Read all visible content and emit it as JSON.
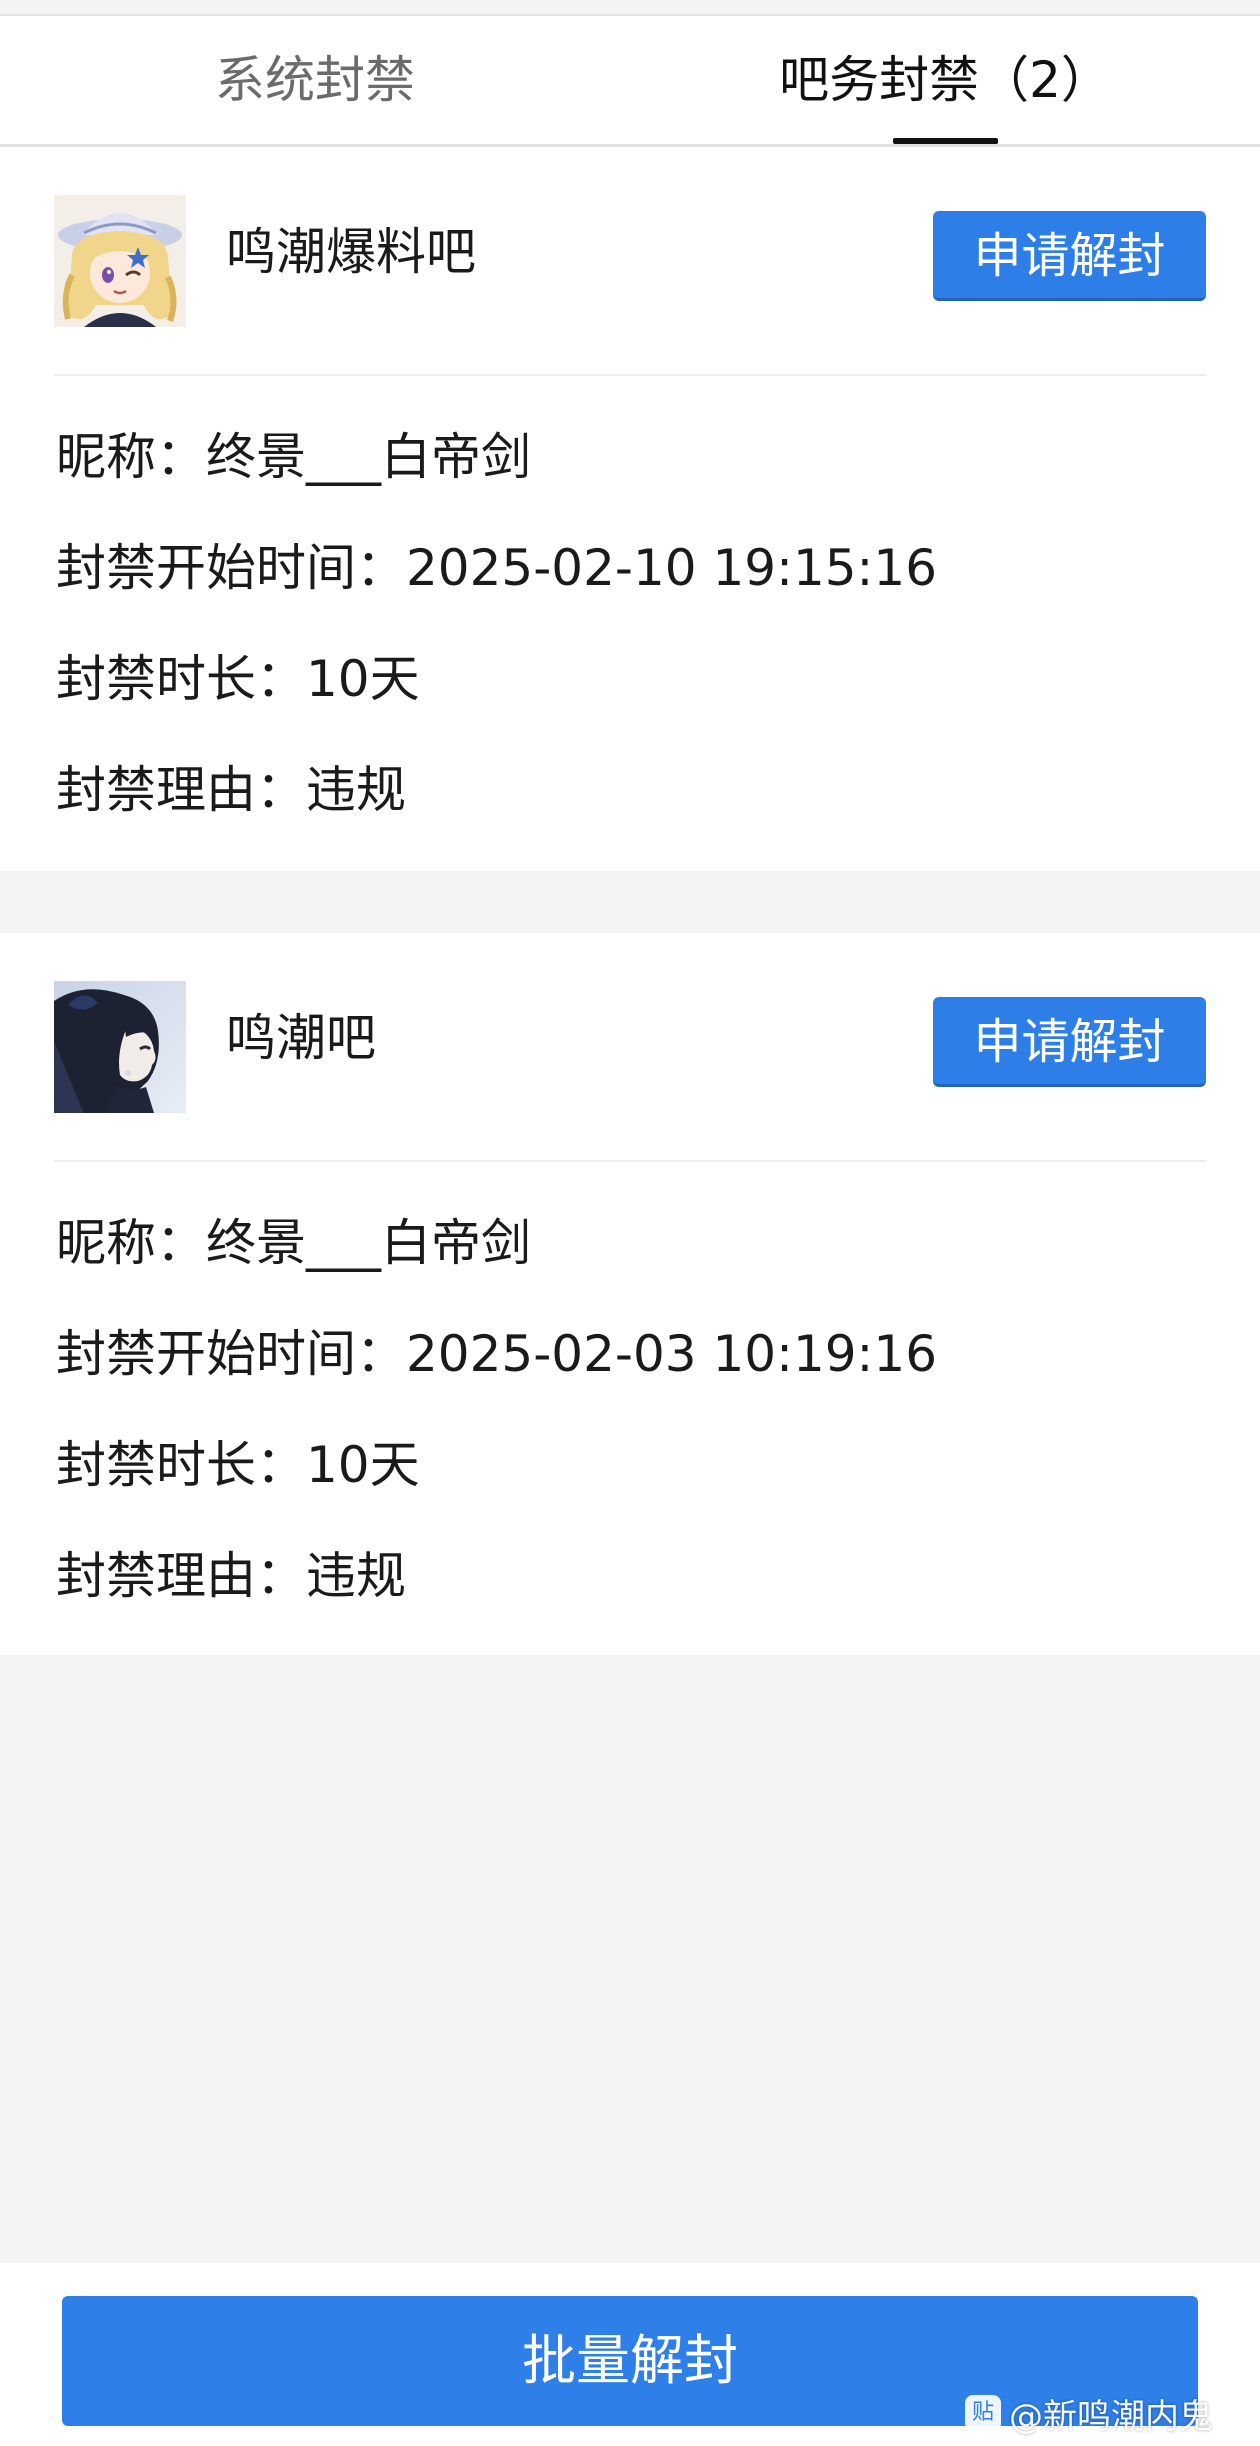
{
  "tabs": {
    "system_label": "系统封禁",
    "forum_label": "吧务封禁（2）"
  },
  "bans": [
    {
      "bar_name": "鸣潮爆料吧",
      "apply_label": "申请解封",
      "nickname_line": "昵称：终景___白帝剑",
      "start_time_line": "封禁开始时间：2025-02-10 19:15:16",
      "duration_line": "封禁时长：10天",
      "reason_line": "封禁理由：违规"
    },
    {
      "bar_name": "鸣潮吧",
      "apply_label": "申请解封",
      "nickname_line": "昵称：终景___白帝剑",
      "start_time_line": "封禁开始时间：2025-02-03 10:19:16",
      "duration_line": "封禁时长：10天",
      "reason_line": "封禁理由：违规"
    }
  ],
  "footer": {
    "batch_label": "批量解封"
  },
  "watermark": {
    "icon_label": "贴",
    "text": "@新鸣潮内鬼"
  },
  "colors": {
    "accent": "#2d7ee6",
    "page_bg": "#f4f4f4",
    "active_tab": "#111111",
    "inactive_tab": "#6b6b6b"
  }
}
